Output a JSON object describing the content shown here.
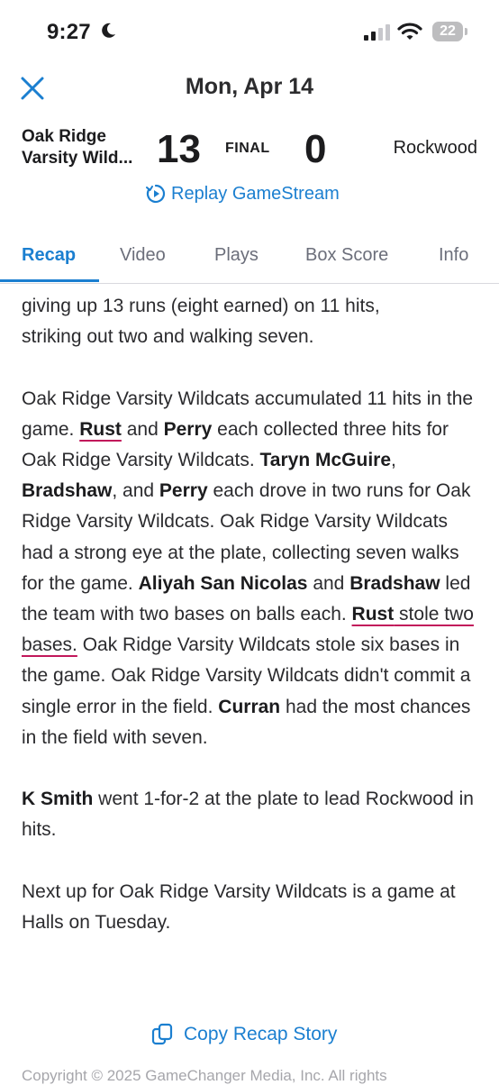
{
  "status_bar": {
    "time": "9:27",
    "battery": "22",
    "icons": [
      "moon-icon",
      "signal-icon",
      "wifi-icon",
      "battery-icon"
    ]
  },
  "header": {
    "title": "Mon, Apr 14",
    "close_icon": "close-icon"
  },
  "score": {
    "home_team_line1": "Oak Ridge",
    "home_team_line2": "Varsity Wild...",
    "home_score": "13",
    "status": "FINAL",
    "away_score": "0",
    "away_team": "Rockwood",
    "replay_label": "Replay GameStream"
  },
  "tabs": [
    {
      "label": "Recap",
      "active": true
    },
    {
      "label": "Video",
      "active": false
    },
    {
      "label": "Plays",
      "active": false
    },
    {
      "label": "Box Score",
      "active": false
    },
    {
      "label": "Info",
      "active": false
    }
  ],
  "story": {
    "p1_l1": "giving up 13 runs (eight earned) on 11 hits,",
    "p1_l2": "striking out two and walking seven.",
    "p2": {
      "t1": "Oak Ridge Varsity Wildcats accumulated 11 hits in the game. ",
      "n_rust": "Rust",
      "t2": " and ",
      "n_perry": "Perry",
      "t3": " each collected three hits for Oak Ridge Varsity Wildcats. ",
      "n_mcguire": "Taryn McGuire",
      "t4": ", ",
      "n_bradshaw": "Bradshaw",
      "t5": ", and ",
      "n_perry2": "Perry",
      "t6": " each drove in two runs for Oak Ridge Varsity Wildcats. Oak Ridge Varsity Wildcats had a strong eye at the plate, collecting seven walks for the game. ",
      "n_sannicolas": "Aliyah San Nicolas",
      "t7": " and ",
      "n_bradshaw2": "Bradshaw",
      "t8": " led the team with two bases on balls each. ",
      "n_rust2": "Rust",
      "t9": " stole two bases.",
      "t10": " Oak Ridge Varsity Wildcats stole six bases in the game. Oak Ridge Varsity Wildcats didn't commit a single error in the field. ",
      "n_curran": "Curran",
      "t11": " had the most chances in the field with seven."
    },
    "p3": {
      "n_smith": "K Smith",
      "t1": " went 1-for-2 at the plate to lead Rockwood in hits."
    },
    "p4": "Next up for Oak Ridge Varsity Wildcats is a game at Halls on Tuesday."
  },
  "copy_button": {
    "label": "Copy Recap Story",
    "icon": "copy-icon"
  },
  "footer": {
    "copyright": "Copyright © 2025 GameChanger Media, Inc. All rights"
  },
  "colors": {
    "accent": "#1b7fd0",
    "underline": "#c2185b",
    "text": "#2b2b2e"
  }
}
